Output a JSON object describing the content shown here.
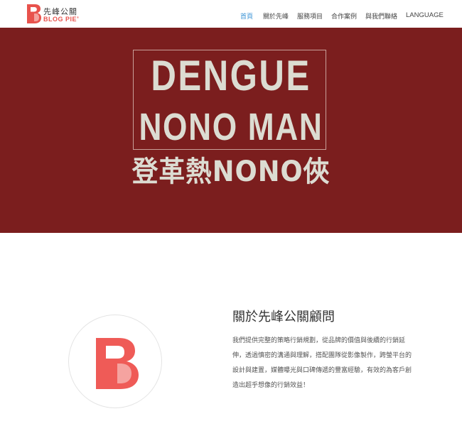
{
  "header": {
    "logo_cn": "先峰公關",
    "logo_en": "BLOG PIE",
    "nav": [
      {
        "label": "首頁",
        "active": true
      },
      {
        "label": "關於先峰",
        "active": false
      },
      {
        "label": "服務項目",
        "active": false
      },
      {
        "label": "合作案例",
        "active": false
      },
      {
        "label": "與我們聯絡",
        "active": false
      },
      {
        "label": "LANGUAGE",
        "active": false
      }
    ]
  },
  "hero": {
    "line1": "DENGUE",
    "line2": "NONO MAN",
    "line3": "登革熱NONO俠",
    "bg_color": "#7b1e1e"
  },
  "about": {
    "title": "關於先峰公關顧問",
    "text": "我們提供完整的策略行銷規劃，從品牌的價值與後續的行銷延伸，透過慎密的溝通與理解，搭配團隊從影像製作，跨螢平台的設計與建置，媒體曝光與口碑傳遞的豐富經驗，有效的為客戶創造出超乎想像的行銷效益！",
    "logo_icon": "blog-pie-b-logo"
  },
  "colors": {
    "brand_red": "#e8524c",
    "nav_active": "#3b93d6"
  }
}
